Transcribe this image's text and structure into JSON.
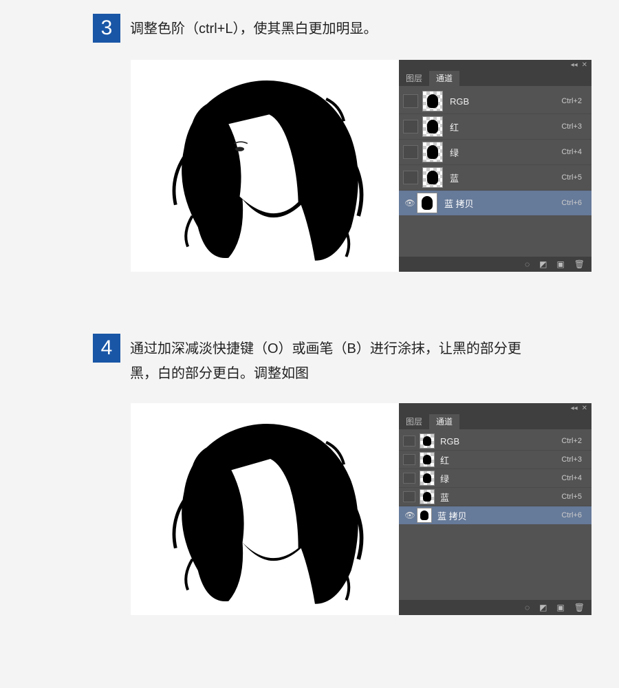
{
  "steps": [
    {
      "num": "3",
      "text": "调整色阶（ctrl+L），使其黑白更加明显。",
      "panel": {
        "tabs": {
          "layers": "图层",
          "channels": "通道"
        },
        "rows": [
          {
            "name": "RGB",
            "shortcut": "Ctrl+2",
            "visible": false,
            "thumb": "checker-head",
            "selected": false
          },
          {
            "name": "红",
            "shortcut": "Ctrl+3",
            "visible": false,
            "thumb": "checker-head",
            "selected": false
          },
          {
            "name": "绿",
            "shortcut": "Ctrl+4",
            "visible": false,
            "thumb": "checker-head",
            "selected": false
          },
          {
            "name": "蓝",
            "shortcut": "Ctrl+5",
            "visible": false,
            "thumb": "checker-head",
            "selected": false
          },
          {
            "name": "蓝 拷贝",
            "shortcut": "Ctrl+6",
            "visible": true,
            "thumb": "white-head",
            "selected": true
          }
        ],
        "compact": false
      }
    },
    {
      "num": "4",
      "text": "通过加深减淡快捷键（O）或画笔（B）进行涂抹，让黑的部分更黑，白的部分更白。调整如图",
      "panel": {
        "tabs": {
          "layers": "图层",
          "channels": "通道"
        },
        "rows": [
          {
            "name": "RGB",
            "shortcut": "Ctrl+2",
            "visible": false,
            "thumb": "checker-head",
            "selected": false
          },
          {
            "name": "红",
            "shortcut": "Ctrl+3",
            "visible": false,
            "thumb": "checker-head",
            "selected": false
          },
          {
            "name": "绿",
            "shortcut": "Ctrl+4",
            "visible": false,
            "thumb": "checker-head",
            "selected": false
          },
          {
            "name": "蓝",
            "shortcut": "Ctrl+5",
            "visible": false,
            "thumb": "checker-head",
            "selected": false
          },
          {
            "name": "蓝 拷贝",
            "shortcut": "Ctrl+6",
            "visible": true,
            "thumb": "white-head",
            "selected": true
          }
        ],
        "compact": true
      }
    }
  ]
}
